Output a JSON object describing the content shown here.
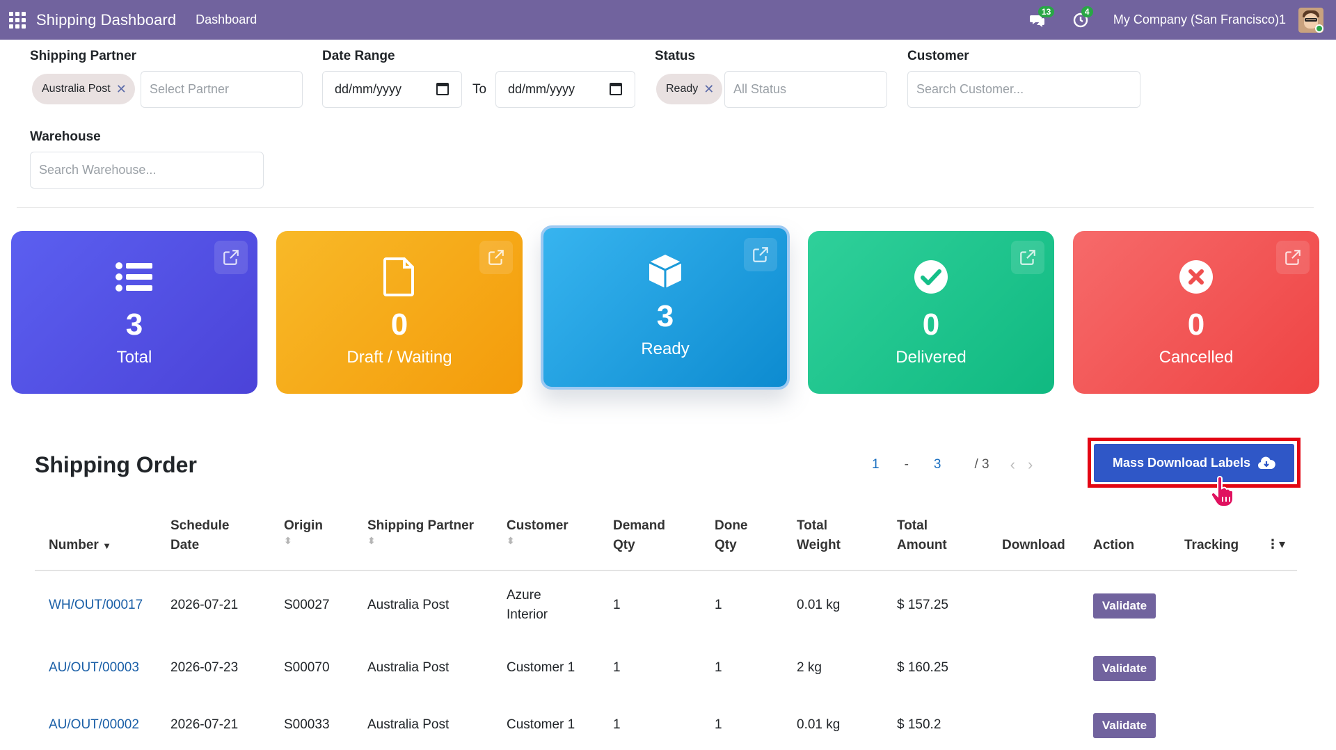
{
  "navbar": {
    "app_title": "Shipping Dashboard",
    "menu_dashboard": "Dashboard",
    "messages_count": "13",
    "activities_count": "4",
    "company": "My Company (San Francisco)1"
  },
  "filters": {
    "shipping_partner_label": "Shipping Partner",
    "partner_chip": "Australia Post",
    "partner_placeholder": "Select Partner",
    "date_range_label": "Date Range",
    "date_from": "dd/mm/yyyy",
    "date_to_label": "To",
    "date_to": "dd/mm/yyyy",
    "status_label": "Status",
    "status_chip": "Ready",
    "status_placeholder": "All Status",
    "customer_label": "Customer",
    "customer_placeholder": "Search Customer...",
    "warehouse_label": "Warehouse",
    "warehouse_placeholder": "Search Warehouse..."
  },
  "cards": {
    "total": {
      "count": "3",
      "label": "Total"
    },
    "draft": {
      "count": "0",
      "label": "Draft / Waiting"
    },
    "ready": {
      "count": "3",
      "label": "Ready"
    },
    "delivered": {
      "count": "0",
      "label": "Delivered"
    },
    "cancelled": {
      "count": "0",
      "label": "Cancelled"
    }
  },
  "section": {
    "title": "Shipping Order",
    "pager_start": "1",
    "pager_sep": "-",
    "pager_end": "3",
    "pager_total": "/ 3",
    "mass_download_label": "Mass Download Labels"
  },
  "table": {
    "headers": {
      "number": "Number",
      "schedule_date_1": "Schedule",
      "schedule_date_2": "Date",
      "origin": "Origin",
      "shipping_partner": "Shipping Partner",
      "customer": "Customer",
      "demand_qty_1": "Demand",
      "demand_qty_2": "Qty",
      "done_qty_1": "Done",
      "done_qty_2": "Qty",
      "total_weight_1": "Total",
      "total_weight_2": "Weight",
      "total_amount_1": "Total",
      "total_amount_2": "Amount",
      "download": "Download",
      "action": "Action",
      "tracking": "Tracking"
    },
    "rows": [
      {
        "number": "WH/OUT/00017",
        "date": "2026-07-21",
        "origin": "S00027",
        "partner": "Australia Post",
        "customer_1": "Azure",
        "customer_2": "Interior",
        "demand": "1",
        "done": "1",
        "weight": "0.01 kg",
        "amount": "$ 157.25",
        "action": "Validate"
      },
      {
        "number": "AU/OUT/00003",
        "date": "2026-07-23",
        "origin": "S00070",
        "partner": "Australia Post",
        "customer_1": "Customer 1",
        "customer_2": "",
        "demand": "1",
        "done": "1",
        "weight": "2 kg",
        "amount": "$ 160.25",
        "action": "Validate"
      },
      {
        "number": "AU/OUT/00002",
        "date": "2026-07-21",
        "origin": "S00033",
        "partner": "Australia Post",
        "customer_1": "Customer 1",
        "customer_2": "",
        "demand": "1",
        "done": "1",
        "weight": "0.01 kg",
        "amount": "$ 150.2",
        "action": "Validate"
      }
    ]
  },
  "colors": {
    "navbar": "#71639e",
    "total_card": "#4f4ee6",
    "draft_card": "#f5a815",
    "ready_card": "#1ba0e2",
    "delivered_card": "#17c38c",
    "cancelled_card": "#f05454",
    "mass_button": "#2f57c7",
    "highlight_border": "#e30613"
  }
}
